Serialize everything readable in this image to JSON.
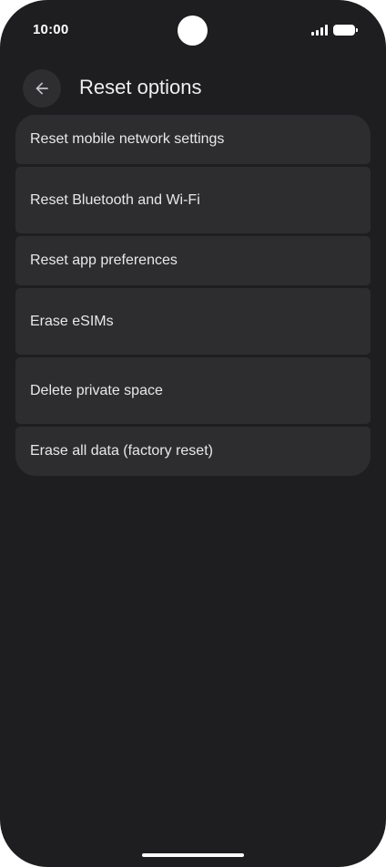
{
  "status_bar": {
    "time": "10:00",
    "icons": [
      "signal-icon",
      "battery-icon"
    ]
  },
  "top_bar": {
    "back_icon": "arrow-left-icon",
    "title": "Reset options"
  },
  "options": [
    {
      "label": "Reset mobile network settings"
    },
    {
      "label": "Reset Bluetooth and Wi-Fi"
    },
    {
      "label": "Reset app preferences"
    },
    {
      "label": "Erase eSIMs"
    },
    {
      "label": "Delete private space"
    },
    {
      "label": "Erase all data (factory reset)"
    }
  ],
  "colors": {
    "background": "#1e1e20",
    "card": "#2d2d30",
    "text": "#e8e8ea"
  }
}
